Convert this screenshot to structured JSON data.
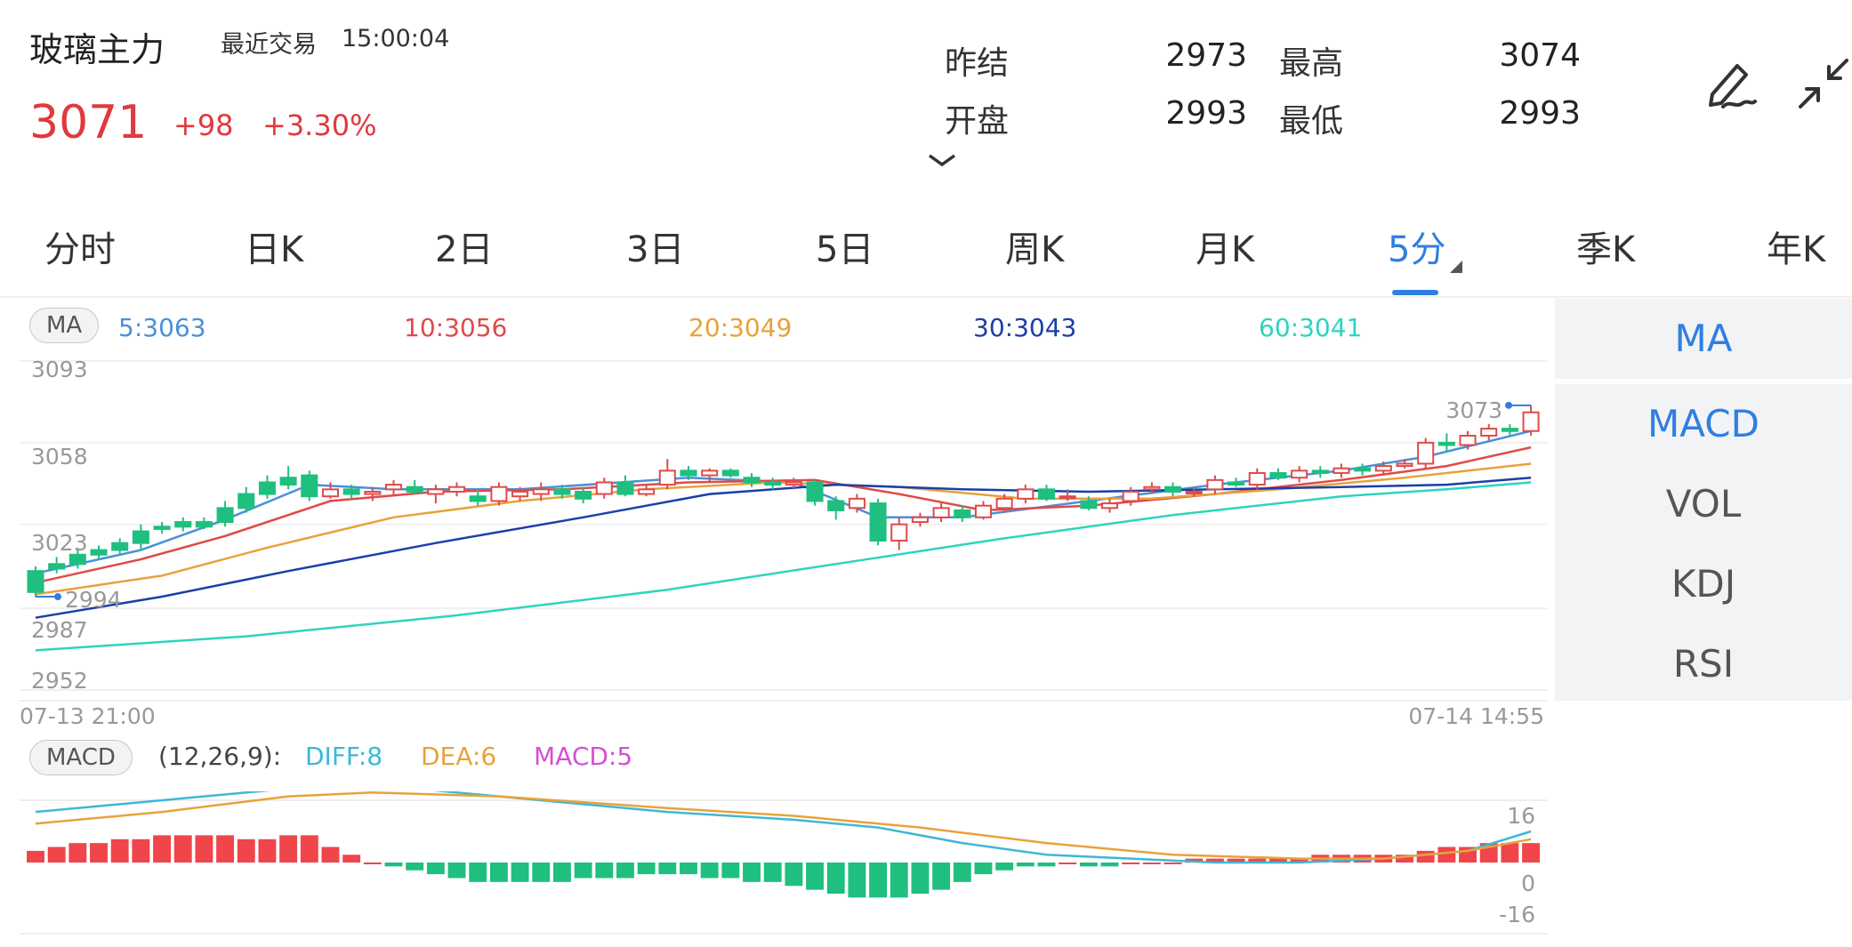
{
  "header": {
    "name": "玻璃主力",
    "last_trade_label": "最近交易",
    "last_trade_time": "15:00:04",
    "price": "3071",
    "change": "+98",
    "change_pct": "+3.30%"
  },
  "quote": {
    "prev_settle_label": "昨结",
    "prev_settle": "2973",
    "high_label": "最高",
    "high": "3074",
    "open_label": "开盘",
    "open": "2993",
    "low_label": "最低",
    "low": "2993"
  },
  "tabs": [
    "分时",
    "日K",
    "2日",
    "3日",
    "5日",
    "周K",
    "月K",
    "5分",
    "季K",
    "年K"
  ],
  "active_tab": "5分",
  "ma_bar": {
    "badge": "MA",
    "items": [
      {
        "label": "5:3063",
        "color": "#4a90d9"
      },
      {
        "label": "10:3056",
        "color": "#e04a4a"
      },
      {
        "label": "20:3049",
        "color": "#e8a23a"
      },
      {
        "label": "30:3043",
        "color": "#1a3fa8"
      },
      {
        "label": "60:3041",
        "color": "#2dd4bf"
      }
    ]
  },
  "indicators": [
    "MA",
    "MACD",
    "VOL",
    "KDJ",
    "RSI"
  ],
  "main_chart": {
    "y_ticks": [
      "3093",
      "3058",
      "3023",
      "2987",
      "2952"
    ],
    "y_tick_values": [
      3093,
      3058,
      3023,
      2987,
      2952
    ],
    "high_marker": "3073",
    "low_marker": "2994",
    "x_start": "07-13  21:00",
    "x_end": "07-14  14:55",
    "colors": {
      "up": "#e04a4a",
      "down": "#1fbf7f"
    }
  },
  "macd_bar": {
    "badge": "MACD",
    "params": "(12,26,9):",
    "diff": "DIFF:8",
    "dea": "DEA:6",
    "macd": "MACD:5",
    "diff_color": "#3db8d6",
    "dea_color": "#e8a23a",
    "macd_color": "#d64fd6",
    "y_ticks": [
      "16",
      "0",
      "-16"
    ]
  },
  "chart_data": {
    "type": "candlestick",
    "y_range": [
      2952,
      3093
    ],
    "candles": [
      [
        3003,
        2994,
        3005,
        2992
      ],
      [
        3006,
        3004,
        3009,
        3002
      ],
      [
        3010,
        3006,
        3013,
        3004
      ],
      [
        3012,
        3010,
        3014,
        3008
      ],
      [
        3015,
        3012,
        3017,
        3010
      ],
      [
        3020,
        3015,
        3023,
        3012
      ],
      [
        3022,
        3021,
        3024,
        3019
      ],
      [
        3024,
        3022,
        3026,
        3020
      ],
      [
        3024,
        3022,
        3026,
        3021
      ],
      [
        3030,
        3024,
        3033,
        3022
      ],
      [
        3036,
        3030,
        3039,
        3028
      ],
      [
        3041,
        3036,
        3044,
        3034
      ],
      [
        3043,
        3040,
        3048,
        3038
      ],
      [
        3044,
        3035,
        3046,
        3033
      ],
      [
        3035,
        3038,
        3041,
        3034
      ],
      [
        3038,
        3036,
        3040,
        3034
      ],
      [
        3036,
        3037,
        3039,
        3033
      ],
      [
        3038,
        3040,
        3042,
        3035
      ],
      [
        3039,
        3037,
        3042,
        3036
      ],
      [
        3036,
        3038,
        3040,
        3032
      ],
      [
        3037,
        3039,
        3041,
        3035
      ],
      [
        3035,
        3033,
        3038,
        3031
      ],
      [
        3033,
        3039,
        3041,
        3031
      ],
      [
        3035,
        3037,
        3039,
        3033
      ],
      [
        3036,
        3038,
        3041,
        3033
      ],
      [
        3038,
        3036,
        3040,
        3034
      ],
      [
        3037,
        3034,
        3039,
        3032
      ],
      [
        3036,
        3041,
        3043,
        3034
      ],
      [
        3041,
        3036,
        3044,
        3035
      ],
      [
        3036,
        3038,
        3040,
        3035
      ],
      [
        3040,
        3046,
        3051,
        3038
      ],
      [
        3046,
        3044,
        3048,
        3042
      ],
      [
        3044,
        3046,
        3047,
        3041
      ],
      [
        3046,
        3044,
        3047,
        3043
      ],
      [
        3043,
        3041,
        3045,
        3039
      ],
      [
        3041,
        3040,
        3043,
        3038
      ],
      [
        3040,
        3041,
        3043,
        3038
      ],
      [
        3041,
        3033,
        3042,
        3031
      ],
      [
        3033,
        3029,
        3035,
        3025
      ],
      [
        3030,
        3034,
        3036,
        3028
      ],
      [
        3032,
        3016,
        3034,
        3014
      ],
      [
        3016,
        3023,
        3026,
        3012
      ],
      [
        3024,
        3026,
        3028,
        3022
      ],
      [
        3026,
        3030,
        3032,
        3024
      ],
      [
        3029,
        3026,
        3031,
        3024
      ],
      [
        3026,
        3031,
        3033,
        3025
      ],
      [
        3030,
        3034,
        3036,
        3028
      ],
      [
        3034,
        3038,
        3040,
        3032
      ],
      [
        3038,
        3034,
        3040,
        3033
      ],
      [
        3035,
        3035,
        3038,
        3033
      ],
      [
        3033,
        3030,
        3035,
        3029
      ],
      [
        3030,
        3032,
        3034,
        3028
      ],
      [
        3033,
        3037,
        3039,
        3031
      ],
      [
        3038,
        3039,
        3041,
        3036
      ],
      [
        3039,
        3037,
        3041,
        3035
      ],
      [
        3037,
        3037,
        3039,
        3035
      ],
      [
        3038,
        3042,
        3044,
        3036
      ],
      [
        3041,
        3040,
        3043,
        3039
      ],
      [
        3040,
        3045,
        3047,
        3038
      ],
      [
        3045,
        3043,
        3047,
        3042
      ],
      [
        3043,
        3046,
        3048,
        3041
      ],
      [
        3046,
        3045,
        3048,
        3043
      ],
      [
        3045,
        3047,
        3049,
        3043
      ],
      [
        3047,
        3046,
        3049,
        3044
      ],
      [
        3046,
        3048,
        3050,
        3044
      ],
      [
        3048,
        3049,
        3051,
        3047
      ],
      [
        3049,
        3058,
        3060,
        3047
      ],
      [
        3058,
        3057,
        3062,
        3054
      ],
      [
        3057,
        3061,
        3063,
        3055
      ],
      [
        3061,
        3064,
        3066,
        3059
      ],
      [
        3064,
        3063,
        3066,
        3061
      ],
      [
        3063,
        3071,
        3074,
        3061
      ]
    ],
    "ma": {
      "ma5": [
        [
          0,
          3002
        ],
        [
          5,
          3012
        ],
        [
          9,
          3025
        ],
        [
          13,
          3040
        ],
        [
          17,
          3038
        ],
        [
          23,
          3038
        ],
        [
          31,
          3043
        ],
        [
          36,
          3041
        ],
        [
          40,
          3026
        ],
        [
          44,
          3026
        ],
        [
          50,
          3033
        ],
        [
          56,
          3040
        ],
        [
          62,
          3046
        ],
        [
          66,
          3052
        ],
        [
          71,
          3063
        ]
      ],
      "ma10": [
        [
          0,
          2998
        ],
        [
          5,
          3008
        ],
        [
          9,
          3018
        ],
        [
          14,
          3033
        ],
        [
          19,
          3037
        ],
        [
          25,
          3038
        ],
        [
          31,
          3041
        ],
        [
          37,
          3042
        ],
        [
          41,
          3036
        ],
        [
          45,
          3029
        ],
        [
          50,
          3031
        ],
        [
          56,
          3036
        ],
        [
          62,
          3042
        ],
        [
          67,
          3048
        ],
        [
          71,
          3056
        ]
      ],
      "ma20": [
        [
          0,
          2993
        ],
        [
          6,
          3001
        ],
        [
          11,
          3013
        ],
        [
          17,
          3026
        ],
        [
          23,
          3033
        ],
        [
          29,
          3038
        ],
        [
          35,
          3041
        ],
        [
          41,
          3039
        ],
        [
          47,
          3034
        ],
        [
          53,
          3034
        ],
        [
          59,
          3038
        ],
        [
          65,
          3043
        ],
        [
          71,
          3049
        ]
      ],
      "ma30": [
        [
          0,
          2983
        ],
        [
          6,
          2992
        ],
        [
          12,
          3003
        ],
        [
          19,
          3015
        ],
        [
          26,
          3026
        ],
        [
          32,
          3036
        ],
        [
          38,
          3040
        ],
        [
          44,
          3038
        ],
        [
          50,
          3037
        ],
        [
          56,
          3038
        ],
        [
          62,
          3039
        ],
        [
          67,
          3040
        ],
        [
          71,
          3043
        ]
      ],
      "ma60": [
        [
          0,
          2969
        ],
        [
          10,
          2975
        ],
        [
          20,
          2984
        ],
        [
          30,
          2995
        ],
        [
          38,
          3006
        ],
        [
          46,
          3017
        ],
        [
          54,
          3027
        ],
        [
          62,
          3035
        ],
        [
          67,
          3038
        ],
        [
          71,
          3041
        ]
      ]
    },
    "macd": {
      "y_range": [
        -16,
        16
      ],
      "hist": [
        3,
        4,
        5,
        5,
        6,
        6,
        7,
        7,
        7,
        7,
        6,
        6,
        7,
        7,
        4,
        2,
        0,
        -1,
        -2,
        -3,
        -4,
        -5,
        -5,
        -5,
        -5,
        -5,
        -4,
        -4,
        -4,
        -3,
        -3,
        -3,
        -4,
        -4,
        -5,
        -5,
        -6,
        -7,
        -8,
        -9,
        -9,
        -9,
        -8,
        -7,
        -5,
        -3,
        -2,
        -1,
        -1,
        0,
        -1,
        -1,
        0,
        0,
        0,
        1,
        1,
        1,
        1,
        1,
        1,
        2,
        2,
        2,
        2,
        2,
        3,
        4,
        4,
        5,
        5,
        5
      ],
      "diff": [
        [
          0,
          13
        ],
        [
          6,
          16
        ],
        [
          10,
          18
        ],
        [
          14,
          20
        ],
        [
          18,
          19
        ],
        [
          24,
          16
        ],
        [
          30,
          13
        ],
        [
          36,
          11
        ],
        [
          40,
          9
        ],
        [
          44,
          5
        ],
        [
          48,
          2
        ],
        [
          52,
          1
        ],
        [
          56,
          0
        ],
        [
          60,
          0
        ],
        [
          64,
          1
        ],
        [
          68,
          3
        ],
        [
          71,
          8
        ]
      ],
      "dea": [
        [
          0,
          10
        ],
        [
          6,
          13
        ],
        [
          12,
          17
        ],
        [
          16,
          18
        ],
        [
          22,
          17
        ],
        [
          30,
          14
        ],
        [
          36,
          12
        ],
        [
          42,
          9
        ],
        [
          48,
          5
        ],
        [
          54,
          2
        ],
        [
          60,
          1
        ],
        [
          64,
          1
        ],
        [
          68,
          3
        ],
        [
          71,
          6
        ]
      ]
    }
  }
}
